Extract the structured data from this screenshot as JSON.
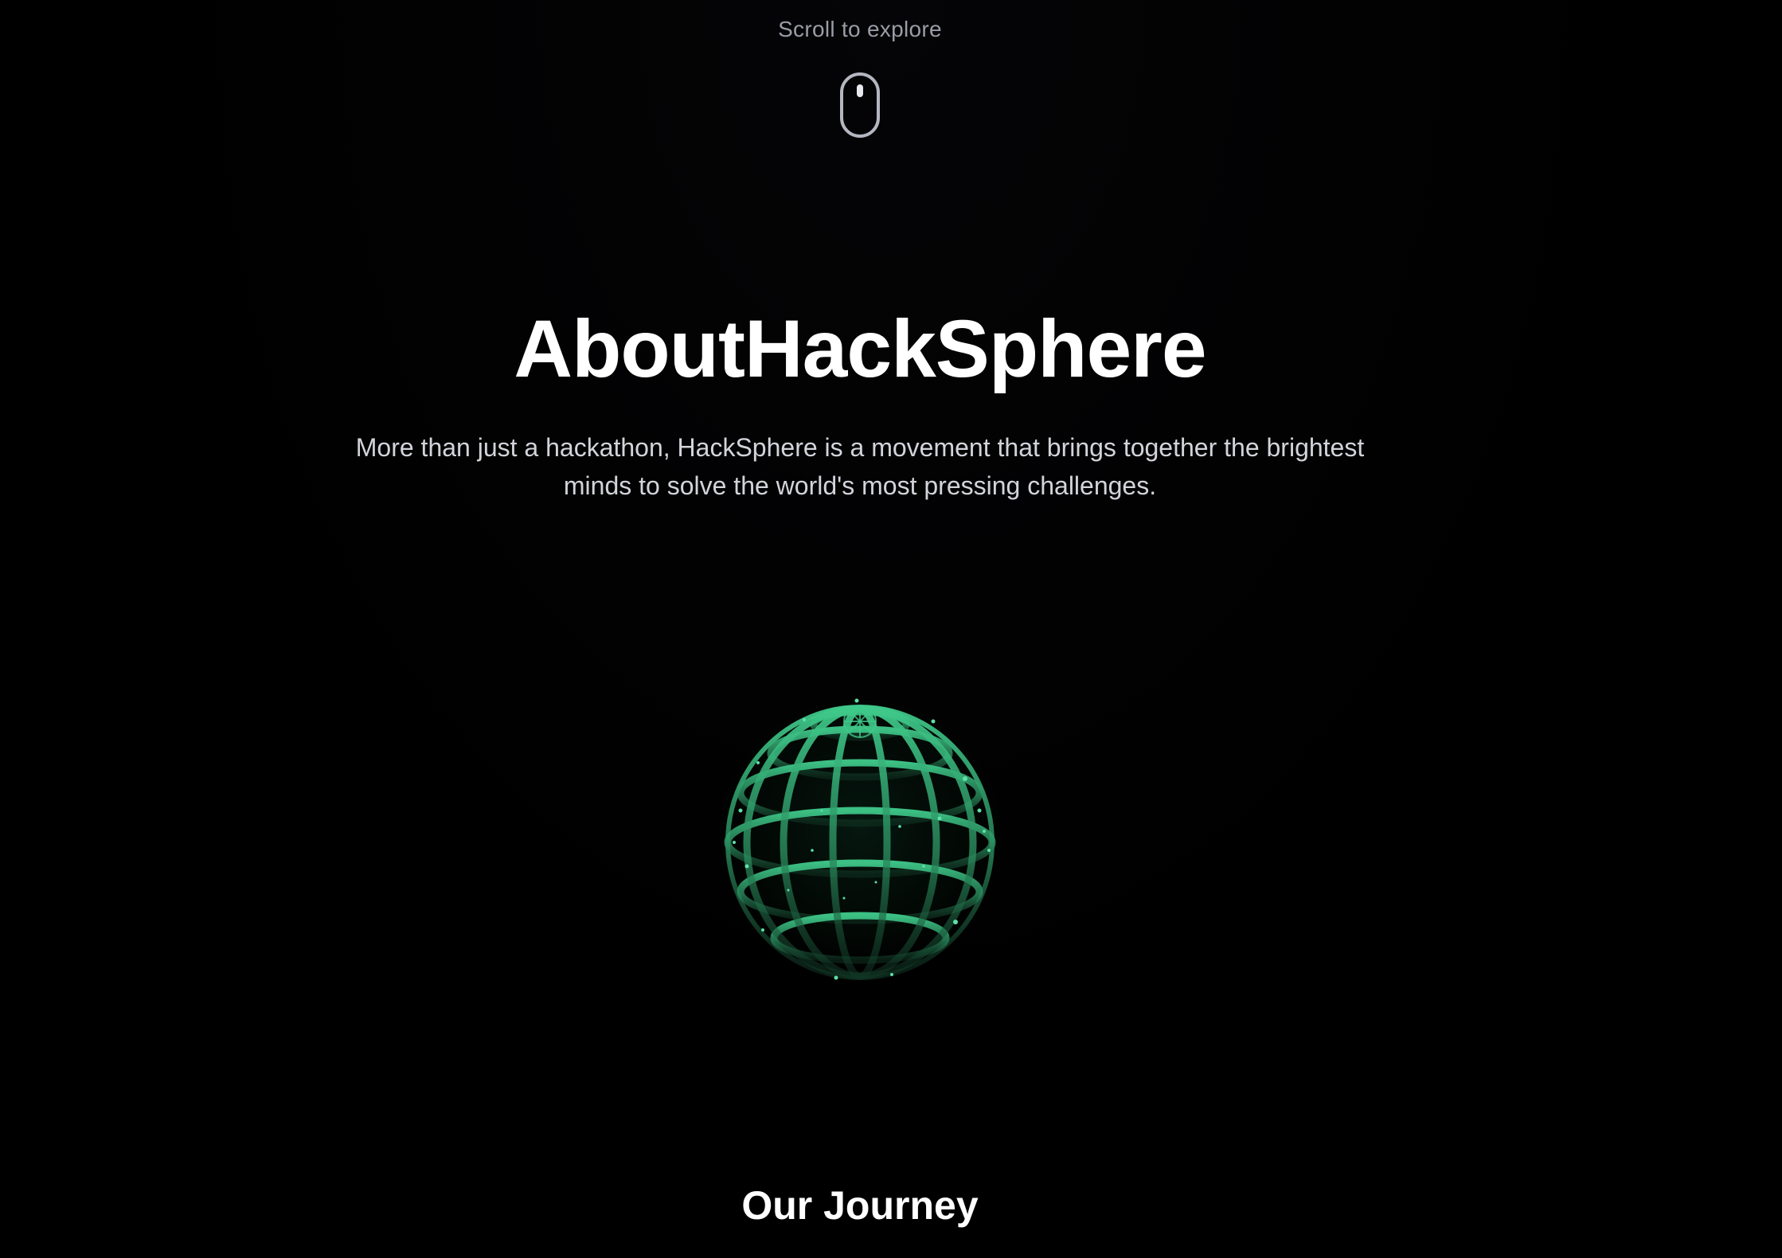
{
  "scroll_hint": {
    "text": "Scroll to explore",
    "icon": "mouse-icon"
  },
  "about": {
    "title": "AboutHackSphere",
    "description": "More than just a hackathon, HackSphere is a movement that brings together the brightest minds to solve the world's most pressing challenges."
  },
  "globe": {
    "icon": "globe-wireframe-icon",
    "color": "#2fa86c"
  },
  "journey": {
    "heading": "Our Journey"
  },
  "colors": {
    "background": "#000000",
    "text_primary": "#ffffff",
    "text_muted": "#9a9ca6",
    "text_body": "#d2d4da",
    "accent_green": "#2fa86c"
  }
}
